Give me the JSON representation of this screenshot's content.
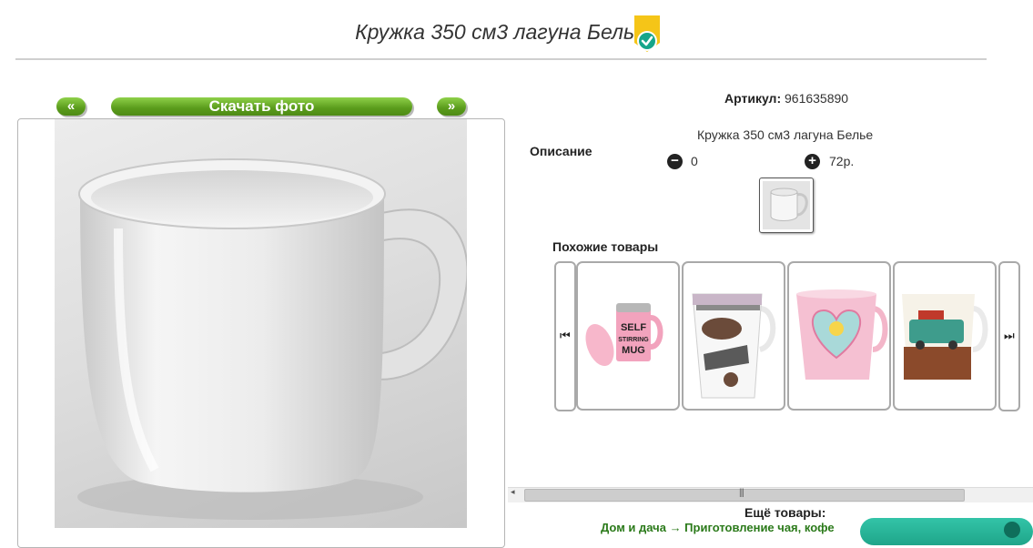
{
  "product": {
    "title": "Кружка 350 см3 лагуна Белье",
    "sku_label": "Артикул:",
    "sku_value": "961635890",
    "description_label": "Описание",
    "description_text": "Кружка 350 см3 лагуна Белье",
    "minus_value": "0",
    "plus_value": "72р."
  },
  "gallery": {
    "prev_label": "«",
    "download_label": "Скачать фото",
    "next_label": "»"
  },
  "similar": {
    "label": "Похожие товары",
    "cards": [
      {
        "name": "self-stirring-mug",
        "text_lines": [
          "SELF",
          "STIRRING",
          "MUG"
        ]
      },
      {
        "name": "car-pattern-mug",
        "text_lines": []
      },
      {
        "name": "heart-pattern-mug",
        "text_lines": []
      },
      {
        "name": "cafe-car-mug",
        "text_lines": []
      }
    ],
    "prev_arrow_icon": "skip-back-icon",
    "next_arrow_icon": "skip-forward-icon"
  },
  "more": {
    "label": "Ещё товары:",
    "links_text": "Дом и дача → Приготовление чая, кофе"
  },
  "icons": {
    "badge": "verified-badge-icon",
    "minus": "minus-icon",
    "plus": "plus-icon"
  },
  "colors": {
    "accent_green": "#5a9b1b",
    "badge_yellow": "#f5c518",
    "badge_teal": "#16a58a",
    "link_green": "#2b7a1a",
    "pill_teal": "#1fa58a"
  }
}
